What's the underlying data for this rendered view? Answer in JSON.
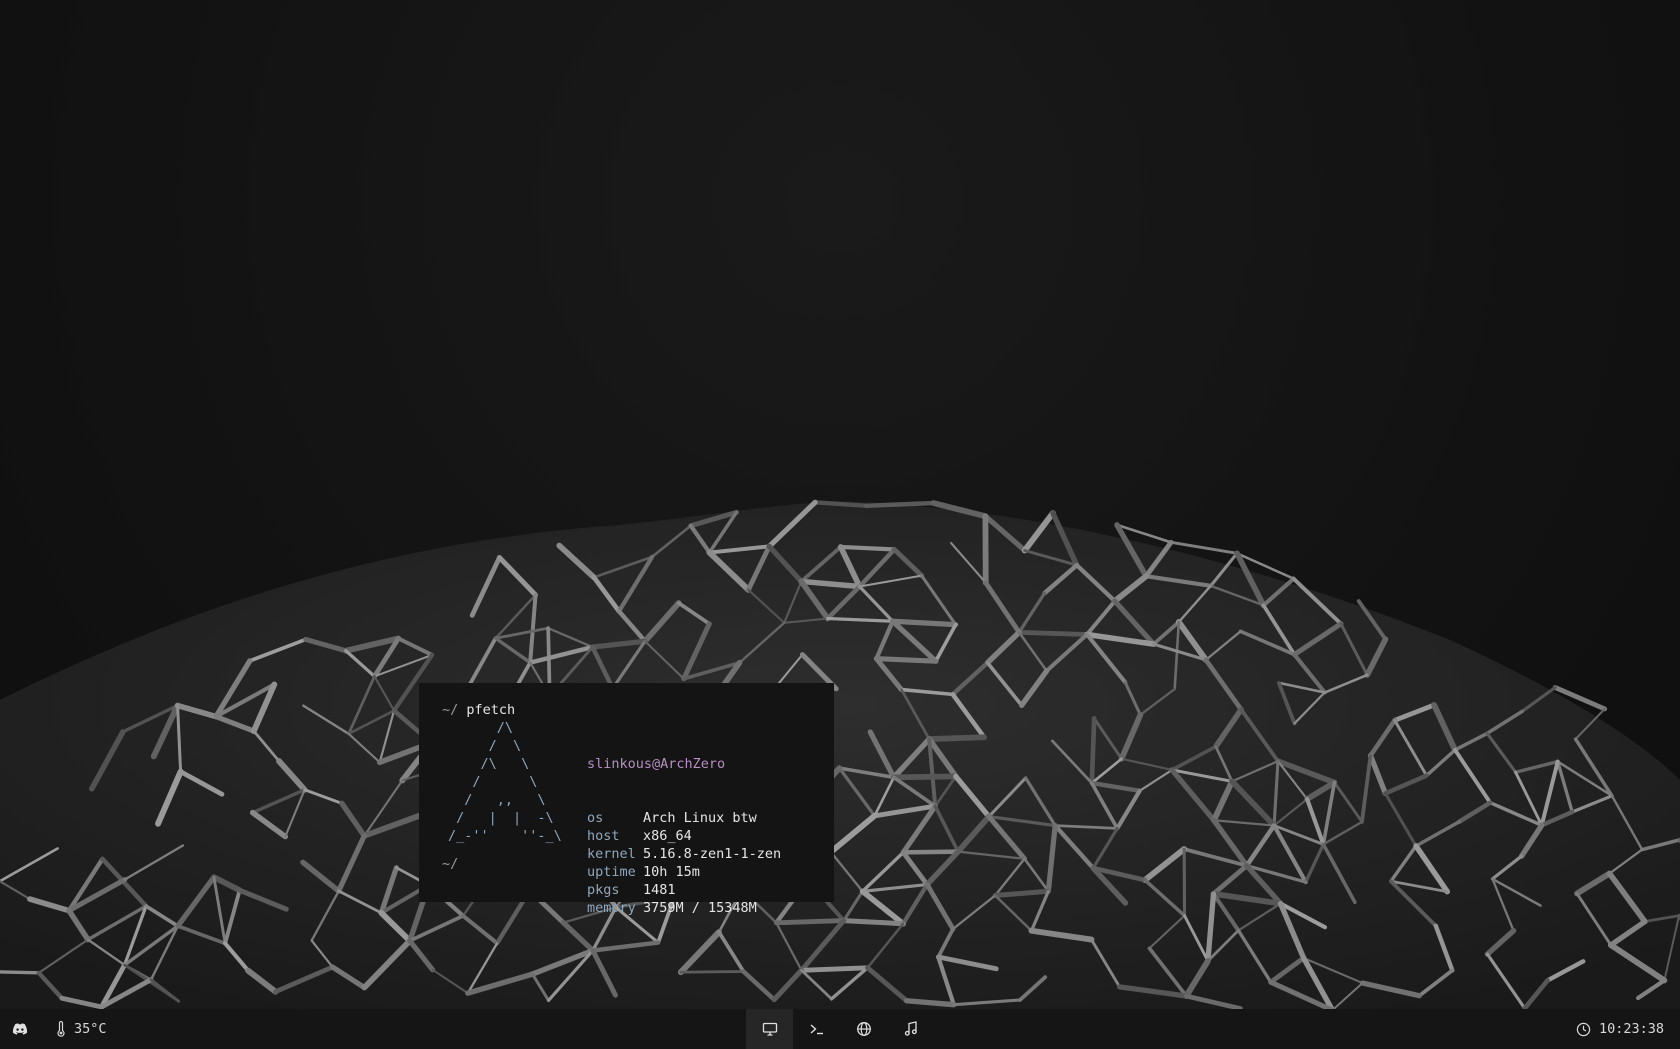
{
  "terminal": {
    "prompt_symbol": "~/",
    "command": "pfetch",
    "ascii_art": "      /\\\n     /  \\\n    /\\   \\\n   /      \\\n  /   ,,   \\\n /   |  |  -\\\n/_-''    ''-_\\",
    "fetch": {
      "title": "slinkous@ArchZero",
      "rows": [
        {
          "key": "os",
          "value": "Arch Linux btw"
        },
        {
          "key": "host",
          "value": "x86_64"
        },
        {
          "key": "kernel",
          "value": "5.16.8-zen1-1-zen"
        },
        {
          "key": "uptime",
          "value": "10h 15m"
        },
        {
          "key": "pkgs",
          "value": "1481"
        },
        {
          "key": "memory",
          "value": "3759M / 15348M"
        }
      ]
    },
    "prompt2": "~/"
  },
  "taskbar": {
    "left": {
      "discord_icon": "discord-icon",
      "temperature_icon": "thermometer-icon",
      "temperature": "35°C"
    },
    "workspaces": [
      {
        "icon": "monitor-icon",
        "active": true
      },
      {
        "icon": "terminal-icon",
        "active": false
      },
      {
        "icon": "globe-icon",
        "active": false
      },
      {
        "icon": "music-icon",
        "active": false
      }
    ],
    "right": {
      "clock_icon": "clock-icon",
      "time": "10:23:38"
    }
  },
  "colors": {
    "background": "#141414",
    "ascii_blue": "#8fa7bd",
    "user_purple": "#b78fc2",
    "taskbar": "#151515",
    "workspace_active": "#262626"
  }
}
